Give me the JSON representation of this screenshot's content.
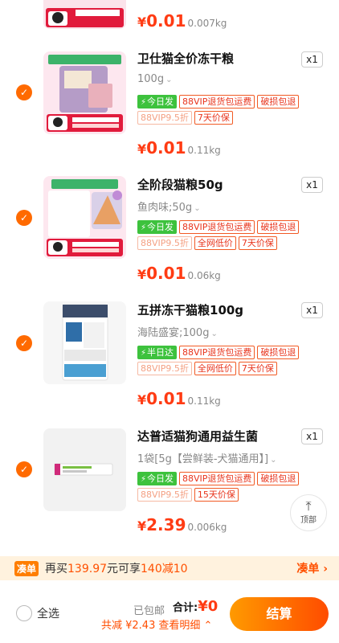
{
  "top_item": {
    "price_yen": "¥",
    "price": "0.01",
    "weight": "0.007kg"
  },
  "items": [
    {
      "title": "卫仕猫全价冻干粮",
      "qty": "x1",
      "spec": "100g",
      "tags_row1": [
        "今日发",
        "88VIP退货包运费",
        "破损包退"
      ],
      "tags_row2": [
        "88VIP9.5折",
        "7天价保"
      ],
      "price_yen": "¥",
      "price": "0.01",
      "weight": "0.11kg",
      "thumb_caption": "一站购齐 极速送达",
      "thumb_store": "正品保障"
    },
    {
      "title": "全阶段猫粮50g",
      "qty": "x1",
      "spec": "鱼肉味;50g",
      "tags_row1": [
        "今日发",
        "88VIP退货包运费",
        "破损包退"
      ],
      "tags_row2": [
        "88VIP9.5折",
        "全网低价",
        "7天价保"
      ],
      "price_yen": "¥",
      "price": "0.01",
      "weight": "0.06kg",
      "thumb_caption": "满足猫咪全阶段需求",
      "thumb_store": "正品保障"
    },
    {
      "title": "五拼冻干猫粮100g",
      "qty": "x1",
      "spec": "海陆盛宴;100g",
      "tags_row1": [
        "半日达",
        "88VIP退货包运费",
        "破损包退"
      ],
      "tags_row2": [
        "88VIP9.5折",
        "全网低价",
        "7天价保"
      ],
      "price_yen": "¥",
      "price": "0.01",
      "weight": "0.11kg",
      "thumb_caption": "NOURSE",
      "thumb_store": ""
    },
    {
      "title": "达普适猫狗通用益生菌",
      "qty": "x1",
      "spec": "1袋[5g【尝鲜装-犬猫通用】]",
      "tags_row1": [
        "今日发",
        "88VIP退货包运费",
        "破损包退"
      ],
      "tags_row2": [
        "88VIP9.5折",
        "15天价保"
      ],
      "price_yen": "¥",
      "price": "2.39",
      "weight": "0.006kg",
      "thumb_caption": "",
      "thumb_store": ""
    }
  ],
  "back_top": {
    "label": "顶部"
  },
  "promo": {
    "badge": "凑单",
    "text_prefix": "再买",
    "amount": "139.97",
    "text_mid": "元可享",
    "offer": "140减10",
    "action": "凑单"
  },
  "footer": {
    "select_all": "全选",
    "free_shipping": "已包邮",
    "total_label": "合计:",
    "total_amount": "¥0",
    "savings": "共减 ¥2.43",
    "detail": "查看明细",
    "checkout": "结算"
  },
  "colors": {
    "accent": "#ff6a00",
    "price": "#ff3b13",
    "green_tag": "#3dc23d"
  }
}
